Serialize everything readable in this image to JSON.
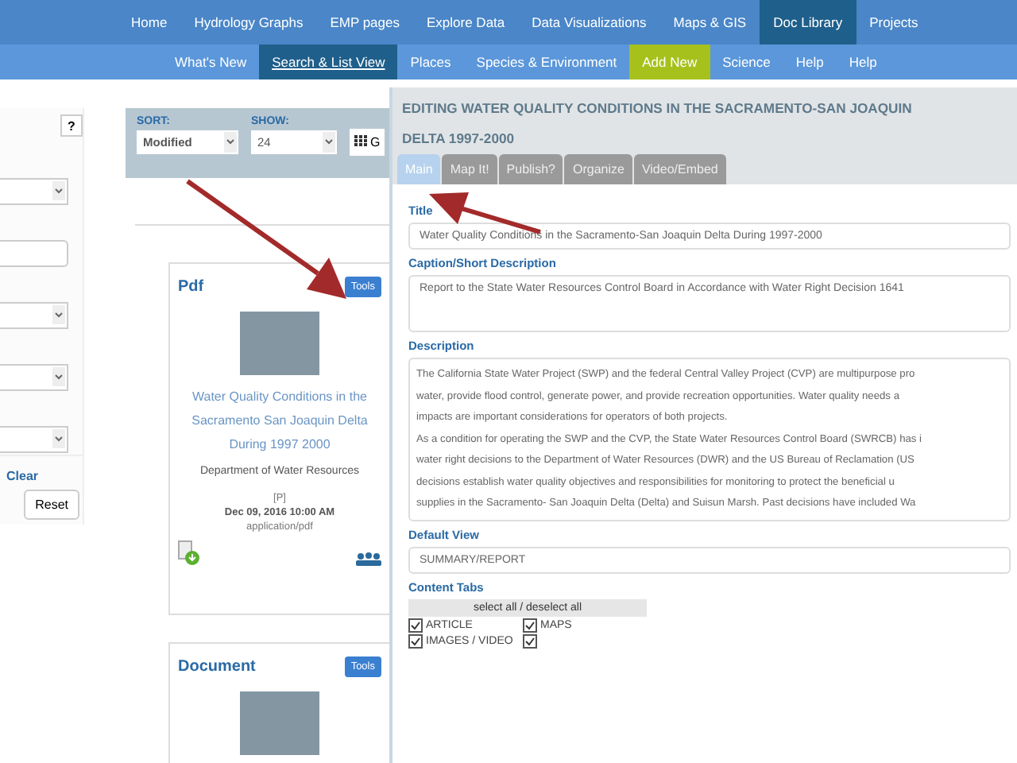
{
  "main_nav": [
    {
      "label": "Home",
      "selected": false
    },
    {
      "label": "Hydrology Graphs",
      "selected": false
    },
    {
      "label": "EMP pages",
      "selected": false
    },
    {
      "label": "Explore Data",
      "selected": false
    },
    {
      "label": "Data Visualizations",
      "selected": false
    },
    {
      "label": "Maps & GIS",
      "selected": false
    },
    {
      "label": "Doc Library",
      "selected": true
    },
    {
      "label": "Projects",
      "selected": false
    }
  ],
  "sub_nav": [
    {
      "label": "What's New",
      "selected": false,
      "kind": "link"
    },
    {
      "label": "Search & List View",
      "selected": true,
      "kind": "link"
    },
    {
      "label": "Places",
      "selected": false,
      "kind": "link"
    },
    {
      "label": "Species & Environment",
      "selected": false,
      "kind": "link"
    },
    {
      "label": "Add New",
      "selected": false,
      "kind": "action"
    },
    {
      "label": "Science",
      "selected": false,
      "kind": "link"
    },
    {
      "label": "Help",
      "selected": false,
      "kind": "link"
    },
    {
      "label": "Help",
      "selected": false,
      "kind": "link"
    }
  ],
  "filter_panel": {
    "help": "?",
    "fields": [
      {
        "kind": "select"
      },
      {
        "kind": "input"
      },
      {
        "kind": "select"
      },
      {
        "kind": "select"
      },
      {
        "kind": "select"
      }
    ],
    "clear": "Clear",
    "reset": "Reset"
  },
  "sort_bar": {
    "sort_label": "SORT:",
    "sort_value": "Modified",
    "show_label": "SHOW:",
    "show_value": "24",
    "view_label": "G"
  },
  "cards": [
    {
      "type": "Pdf",
      "tools": "Tools",
      "title": "Water Quality Conditions in the Sacramento San Joaquin Delta During 1997 2000",
      "source": "Department of Water Resources",
      "flag": "[P]",
      "date": "Dec 09, 2016 10:00 AM",
      "mime": "application/pdf"
    },
    {
      "type": "Document",
      "tools": "Tools"
    }
  ],
  "edit_panel": {
    "heading": "EDITING WATER QUALITY CONDITIONS IN THE SACRAMENTO-SAN JOAQUIN DELTA 1997-2000",
    "tabs": [
      {
        "label": "Main",
        "selected": true
      },
      {
        "label": "Map It!",
        "selected": false
      },
      {
        "label": "Publish?",
        "selected": false
      },
      {
        "label": "Organize",
        "selected": false
      },
      {
        "label": "Video/Embed",
        "selected": false
      }
    ],
    "title_label": "Title",
    "title_value": "Water Quality Conditions in the Sacramento-San Joaquin Delta During 1997-2000",
    "caption_label": "Caption/Short Description",
    "caption_value": "Report to the State Water Resources Control Board in Accordance with Water Right Decision 1641",
    "description_label": "Description",
    "description_lines": [
      "The California State Water Project (SWP) and the federal Central Valley Project (CVP) are multipurpose pro",
      "water, provide flood control, generate power, and provide recreation opportunities. Water quality needs a",
      "impacts are important considerations for operators of both projects.",
      "As a condition for operating the SWP and the CVP, the State Water Resources Control Board (SWRCB) has i",
      "water right decisions to the Department of Water Resources (DWR) and the US Bureau of Reclamation (US",
      "decisions establish water quality objectives and responsibilities for monitoring to protect the beneficial u",
      "supplies in the Sacramento- San Joaquin Delta (Delta) and Suisun Marsh. Past decisions have included Wa"
    ],
    "default_view_label": "Default View",
    "default_view_value": "SUMMARY/REPORT",
    "content_tabs_label": "Content Tabs",
    "select_all": "select all / deselect all",
    "content_tabs": [
      {
        "label": "ARTICLE",
        "checked": true
      },
      {
        "label": "MAPS",
        "checked": true
      },
      {
        "label": "IMAGES / VIDEO",
        "checked": true
      },
      {
        "checked": true
      }
    ]
  }
}
